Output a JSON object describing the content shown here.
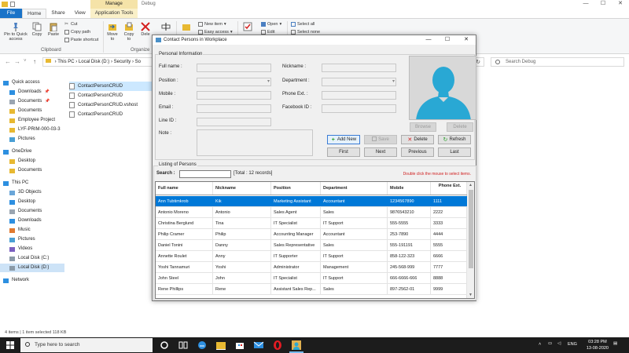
{
  "explorer": {
    "manage_tab": "Manage",
    "context_title": "Debug",
    "tabs": [
      "File",
      "Home",
      "Share",
      "View",
      "Application Tools"
    ],
    "ribbon": {
      "pin": "Pin to Quick access",
      "copy": "Copy",
      "paste": "Paste",
      "cut": "Cut",
      "copy_path": "Copy path",
      "paste_shortcut": "Paste shortcut",
      "move_to": "Move to",
      "copy_to": "Copy to",
      "delete": "Dele",
      "new_item": "New item",
      "easy_access": "Easy access",
      "open": "Open",
      "edit": "Edit",
      "select_all": "Select all",
      "select_none": "Select none",
      "clipboard": "Clipboard",
      "organize": "Organize"
    },
    "address": {
      "path": [
        "This PC",
        "Local Disk (D:)",
        "Security",
        "So"
      ],
      "search_placeholder": "Search Debug"
    },
    "nav": [
      {
        "label": "Quick access",
        "icon": "star-icon"
      },
      {
        "label": "Downloads",
        "icon": "download-icon",
        "pinned": true
      },
      {
        "label": "Documents",
        "icon": "documents-icon",
        "pinned": true
      },
      {
        "label": "Documents",
        "icon": "folder-icon"
      },
      {
        "label": "Employee Project",
        "icon": "folder-icon"
      },
      {
        "label": "LYF-PRIM-000-03-3",
        "icon": "folder-icon"
      },
      {
        "label": "Pictures",
        "icon": "pictures-icon"
      },
      {
        "label": "OneDrive",
        "icon": "cloud-icon"
      },
      {
        "label": "Desktop",
        "icon": "folder-icon"
      },
      {
        "label": "Documents",
        "icon": "folder-icon"
      },
      {
        "label": "This PC",
        "icon": "pc-icon"
      },
      {
        "label": "3D Objects",
        "icon": "cube-icon"
      },
      {
        "label": "Desktop",
        "icon": "desktop-icon"
      },
      {
        "label": "Documents",
        "icon": "documents-icon"
      },
      {
        "label": "Downloads",
        "icon": "download-icon"
      },
      {
        "label": "Music",
        "icon": "music-icon"
      },
      {
        "label": "Pictures",
        "icon": "pictures-icon"
      },
      {
        "label": "Videos",
        "icon": "video-icon"
      },
      {
        "label": "Local Disk (C:)",
        "icon": "disk-icon"
      },
      {
        "label": "Local Disk (D:)",
        "icon": "disk-icon",
        "selected": true
      },
      {
        "label": "Network",
        "icon": "network-icon"
      }
    ],
    "files": [
      {
        "name": "ContactPersonCRUD",
        "selected": true
      },
      {
        "name": "ContactPersonCRUD"
      },
      {
        "name": "ContactPersonCRUD.vshost"
      },
      {
        "name": "ContactPersonCRUD"
      }
    ],
    "status": {
      "items": "4 items",
      "selected": "1 item selected  118 KB"
    }
  },
  "dialog": {
    "title": "Contact Persons in Workplace",
    "personal_group": "Personal Information",
    "labels": {
      "full_name": "Full name :",
      "position": "Position :",
      "mobile": "Mobile :",
      "email": "Email :",
      "line_id": "Line ID :",
      "note": "Note :",
      "nickname": "Nickname :",
      "department": "Department :",
      "phone_ext": "Phone Ext. :",
      "facebook_id": "Facebook ID :"
    },
    "buttons": {
      "browse": "Browse",
      "delete_photo": "Delete",
      "add_new": "Add New",
      "save": "Save",
      "delete": "Delete",
      "refresh": "Refresh",
      "first": "First",
      "next": "Next",
      "previous": "Previous",
      "last": "Last"
    },
    "listing_group": "Listing of Persons",
    "search_label": "Search :",
    "total": "[Total : 12 records]",
    "hint": "Double click the mouse to select items.",
    "columns": [
      "Full name",
      "Nickname",
      "Position",
      "Department",
      "Mobile",
      "Phone Ext."
    ],
    "rows": [
      [
        "Ann Tubtimkrob",
        "Kik",
        "Marketing Assistant",
        "Accountant",
        "1234567890",
        "1111"
      ],
      [
        "Antonio Moreno",
        "Antonio",
        "Sales Agent",
        "Sales",
        "9876543210",
        "2222"
      ],
      [
        "Christina Berglund",
        "Tina",
        "IT Specialist",
        "IT Support",
        "555-5555",
        "3333"
      ],
      [
        "Philip Cramer",
        "Philip",
        "Accounting Manager",
        "Accountant",
        "253-7890",
        "4444"
      ],
      [
        "Daniel Tonini",
        "Danny",
        "Sales Representative",
        "Sales",
        "555-191191",
        "5555"
      ],
      [
        "Annette Roulet",
        "Anny",
        "IT Supporter",
        "IT Support",
        "858-122-323",
        "6666"
      ],
      [
        "Yoshi Tannamuri",
        "Yoshi",
        "Administrator",
        "Management",
        "245-568-999",
        "7777"
      ],
      [
        "John Steel",
        "John",
        "IT Specialist",
        "IT Support",
        "666-6666-666",
        "8888"
      ],
      [
        "Rene Phillips",
        "Rene",
        "Assistant Sales Rep...",
        "Sales",
        "897-2562-01",
        "9999"
      ]
    ]
  },
  "taskbar": {
    "search_placeholder": "Type here to search",
    "lang": "ENG",
    "time": "03:28 PM",
    "date": "13-08-2020"
  },
  "colors": {
    "accent": "#0078d7",
    "file_tab": "#1a73c8",
    "hint_red": "#d02020",
    "avatar": "#29a8d4"
  }
}
